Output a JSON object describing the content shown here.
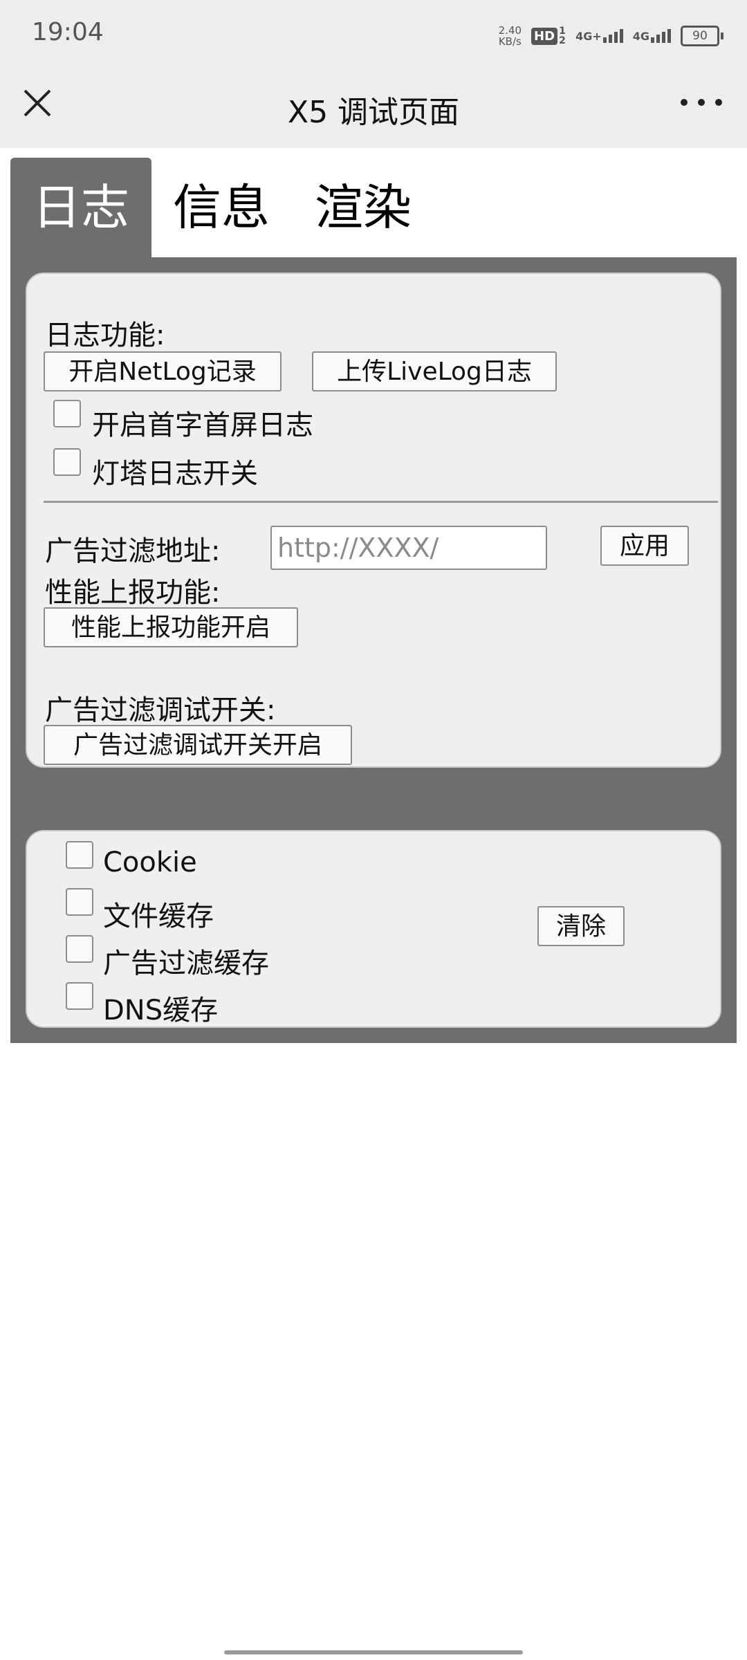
{
  "status_bar": {
    "time": "19:04",
    "net_speed_value": "2.40",
    "net_speed_unit": "KB/s",
    "hd_badge": "HD",
    "hd_sub": "1 2",
    "sim1": "4G+",
    "sim2": "4G",
    "battery": "90"
  },
  "nav": {
    "title": "X5 调试页面",
    "close_icon": "close-icon",
    "more_icon": "more-icon"
  },
  "tabs": [
    {
      "label": "日志",
      "active": true
    },
    {
      "label": "信息",
      "active": false
    },
    {
      "label": "渲染",
      "active": false
    }
  ],
  "log_section": {
    "title": "日志功能:",
    "netlog_button": "开启NetLog记录",
    "livelog_button": "上传LiveLog日志",
    "checkbox_first_screen": "开启首字首屏日志",
    "checkbox_beacon": "灯塔日志开关",
    "ad_filter_label": "广告过滤地址:",
    "ad_filter_placeholder": "http://XXXX/",
    "apply_button": "应用",
    "perf_label": "性能上报功能:",
    "perf_button": "性能上报功能开启",
    "ad_debug_label": "广告过滤调试开关:",
    "ad_debug_button": "广告过滤调试开关开启"
  },
  "cache_section": {
    "items": [
      "Cookie",
      "文件缓存",
      "广告过滤缓存",
      "DNS缓存"
    ],
    "clear_button": "清除"
  },
  "colors": {
    "panel_bg": "#6e6e6e",
    "card_bg": "#efefef",
    "nav_bg": "#ededed"
  }
}
